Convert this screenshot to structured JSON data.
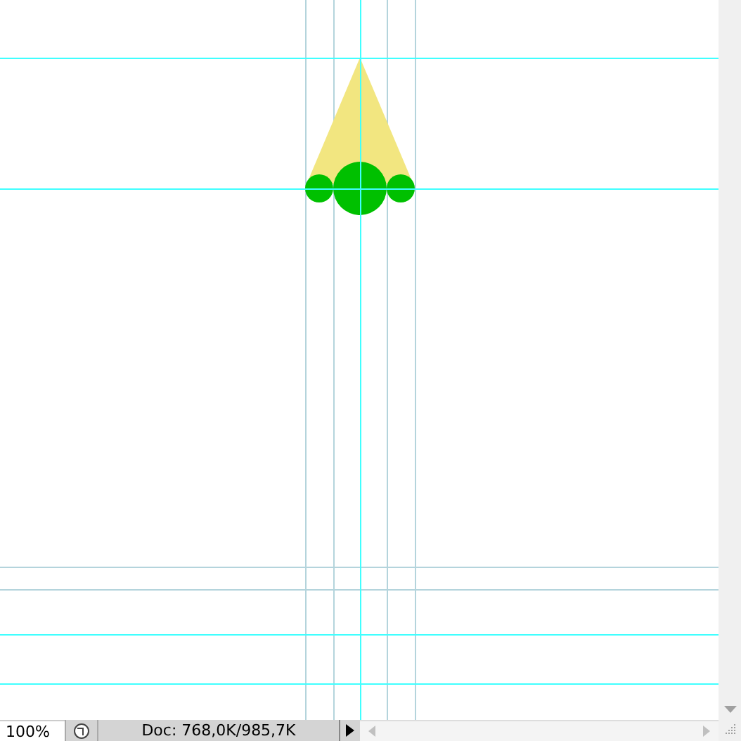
{
  "status_bar": {
    "zoom": "100%",
    "doc_info": "Doc: 768,0K/985,7K"
  }
}
